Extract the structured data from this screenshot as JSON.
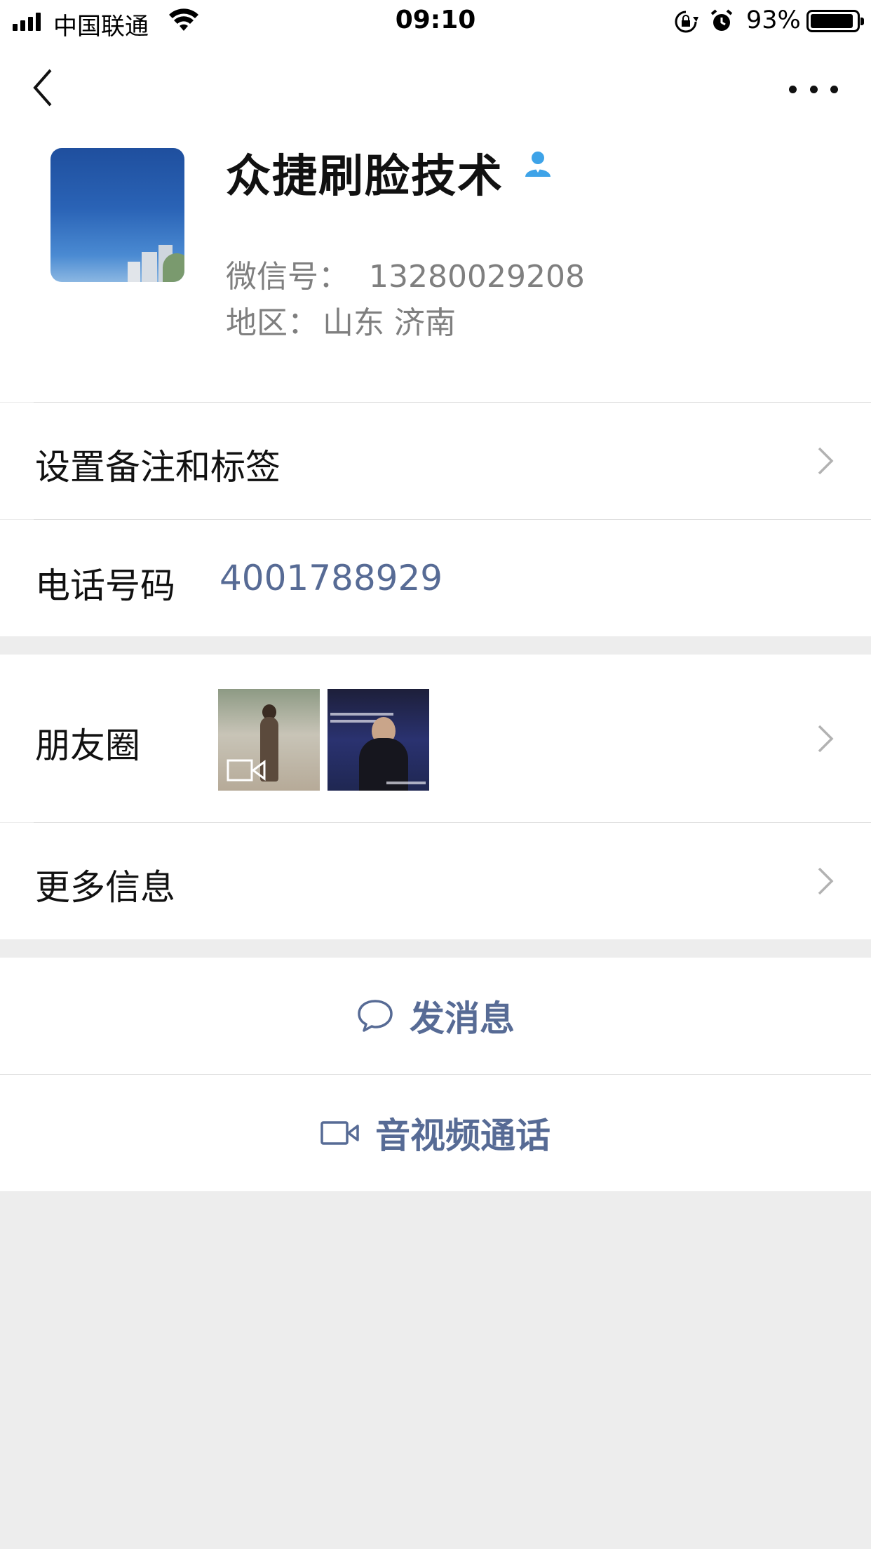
{
  "status_bar": {
    "carrier": "中国联通",
    "time": "09:10",
    "battery_percent": "93%",
    "battery_level": 0.93,
    "icons": [
      "signal-icon",
      "wifi-icon",
      "rotation-lock-icon",
      "alarm-icon",
      "battery-icon"
    ]
  },
  "nav": {
    "back_icon": "chevron-left-icon",
    "more_icon": "more-dots-icon"
  },
  "profile": {
    "name": "众捷刷脸技术",
    "badge_icon": "contact-person-icon",
    "wechat_id_label": "微信号：",
    "wechat_id": "13280029208",
    "region_label": "地区：",
    "region": "山东 济南"
  },
  "rows": {
    "remark": {
      "label": "设置备注和标签"
    },
    "phone": {
      "label": "电话号码",
      "value": "4001788929"
    },
    "moments": {
      "label": "朋友圈"
    },
    "more_info": {
      "label": "更多信息"
    }
  },
  "actions": {
    "message": {
      "label": "发消息",
      "icon": "chat-bubble-icon"
    },
    "call": {
      "label": "音视频通话",
      "icon": "video-camera-icon"
    }
  },
  "colors": {
    "link_blue": "#576b95",
    "background": "#ededed",
    "badge_blue": "#3ea3e8"
  }
}
